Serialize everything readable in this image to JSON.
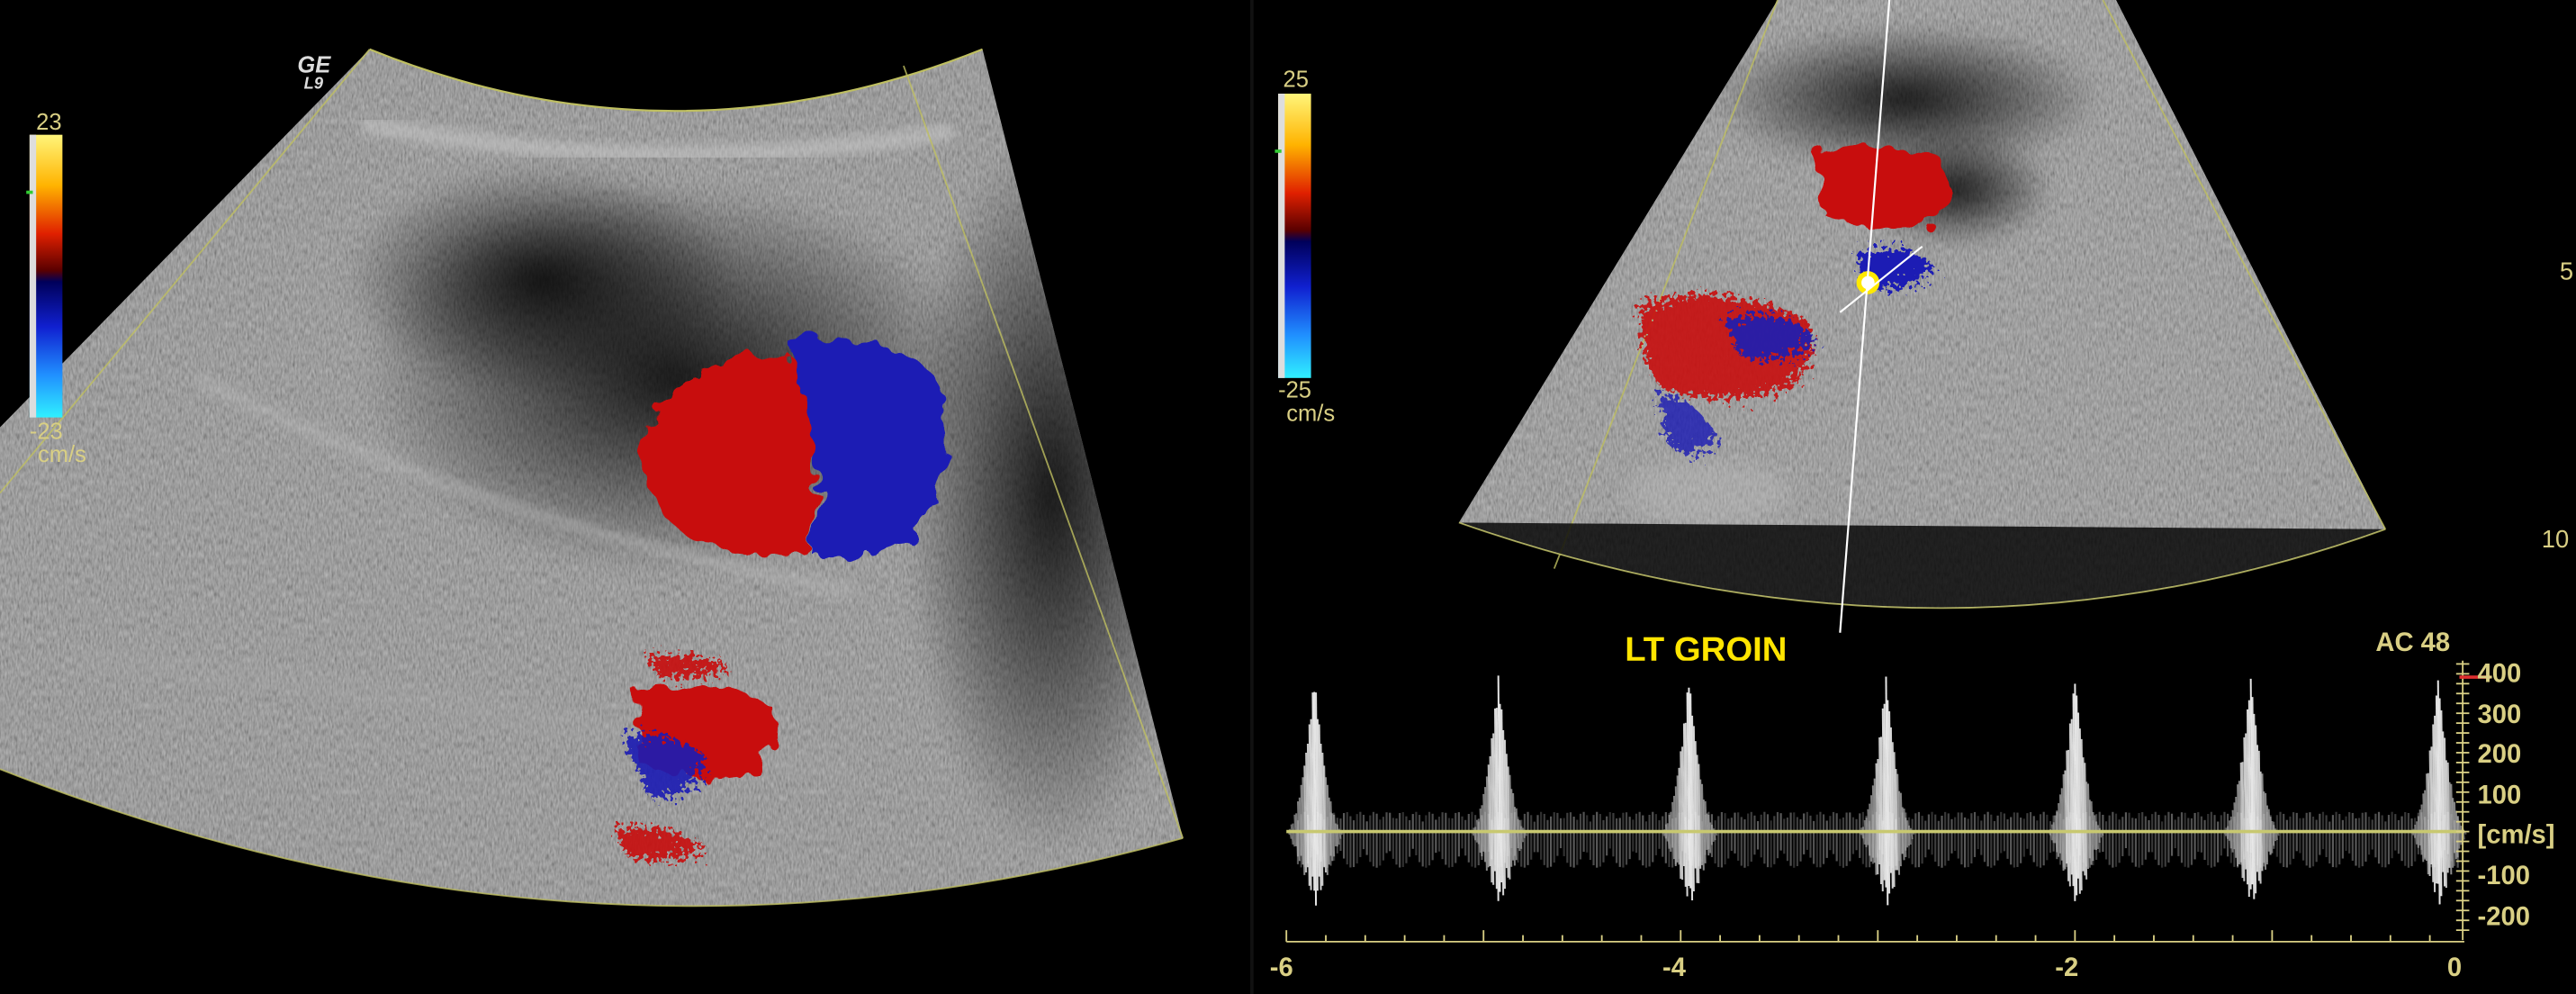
{
  "logo": {
    "line1": "GE",
    "line2": "L9"
  },
  "left_scale": {
    "max": "23",
    "min": "-23",
    "unit": "cm/s"
  },
  "right_scale": {
    "max": "25",
    "min": "-25",
    "unit": "cm/s"
  },
  "depth_marks": [
    "5",
    "10"
  ],
  "annotation": "LT GROIN",
  "ac_label": "AC 48",
  "velocity_axis": {
    "ticks": [
      "400",
      "300",
      "200",
      "100",
      "[cm/s]",
      "-100",
      "-200"
    ],
    "unit": "[cm/s]"
  },
  "time_axis": {
    "ticks": [
      "-6",
      "-4",
      "-2",
      "0"
    ]
  },
  "colors": {
    "scale_text": "#d9cf84",
    "annotation": "#ffe500",
    "doppler_red": "#c8110f",
    "doppler_blue": "#1b1db4",
    "sector_outline": "#bfbf60",
    "baseline": "#c8c870"
  }
}
